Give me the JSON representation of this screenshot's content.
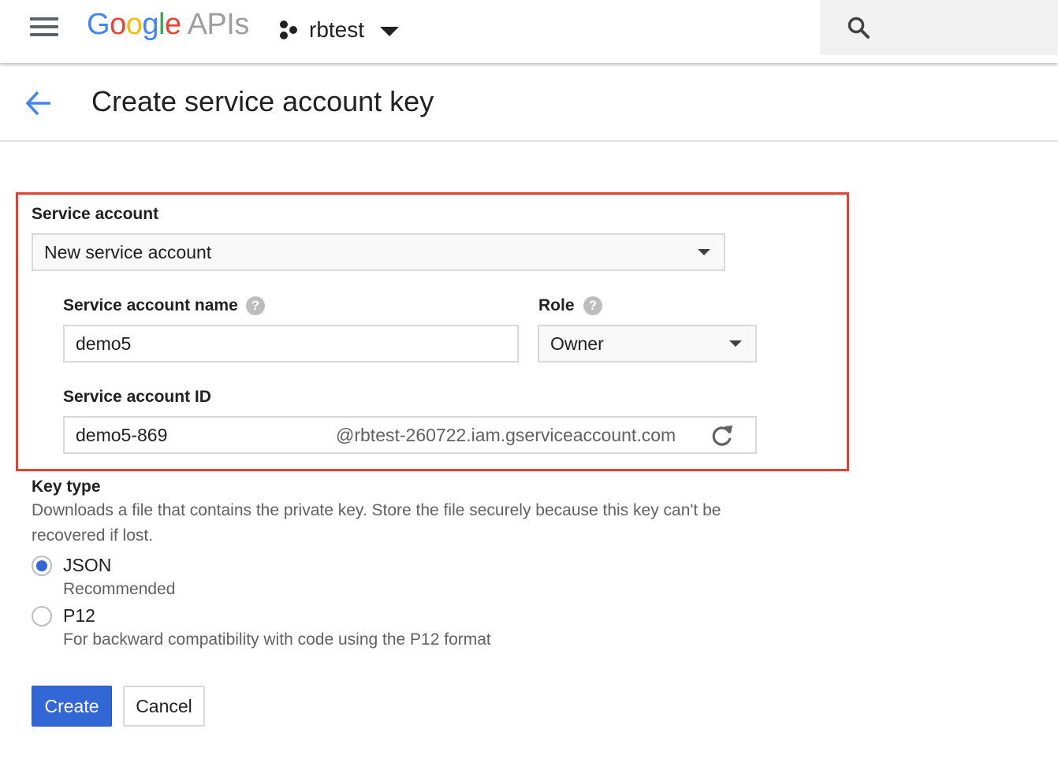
{
  "header": {
    "logo": {
      "g1": "G",
      "o1": "o",
      "o2": "o",
      "g2": "g",
      "l": "l",
      "e": "e",
      "apis": "APIs"
    },
    "project_name": "rbtest",
    "icons": {
      "menu": "hamburger-menu-icon",
      "project": "project-hexagon-icon",
      "project_dropdown": "caret-down-icon",
      "search": "search-icon"
    }
  },
  "page": {
    "title": "Create service account key",
    "back_icon": "arrow-left-icon"
  },
  "form": {
    "service_account": {
      "label": "Service account",
      "selected": "New service account"
    },
    "service_account_name": {
      "label": "Service account name",
      "help": "?",
      "value": "demo5"
    },
    "role": {
      "label": "Role",
      "help": "?",
      "selected": "Owner"
    },
    "service_account_id": {
      "label": "Service account ID",
      "value": "demo5-869",
      "suffix": "@rbtest-260722.iam.gserviceaccount.com",
      "refresh_icon": "refresh-icon"
    },
    "key_type": {
      "label": "Key type",
      "description": "Downloads a file that contains the private key. Store the file securely because this key can't be recovered if lost.",
      "options": [
        {
          "label": "JSON",
          "sublabel": "Recommended",
          "checked": true
        },
        {
          "label": "P12",
          "sublabel": "For backward compatibility with code using the P12 format",
          "checked": false
        }
      ]
    }
  },
  "buttons": {
    "create": "Create",
    "cancel": "Cancel"
  },
  "colors": {
    "accent_blue": "#3367d6",
    "highlight_red": "#e2412d",
    "back_arrow_blue": "#4285f4"
  }
}
